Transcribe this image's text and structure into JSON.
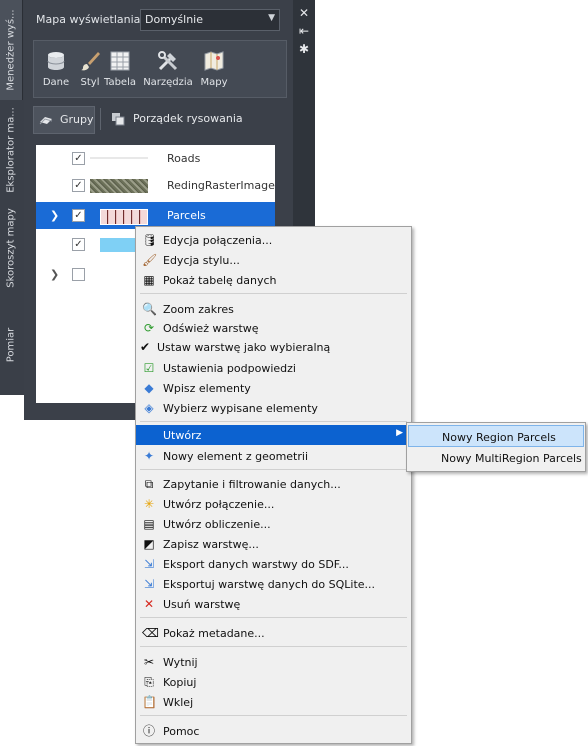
{
  "vertical_tabs": [
    {
      "label": "Menedżer wyś..."
    },
    {
      "label": "Eksplorator ma..."
    },
    {
      "label": "Skoroszyt mapy"
    },
    {
      "label": "Pomiar"
    }
  ],
  "header": {
    "map_label": "Mapa wyświetlania:",
    "map_select_value": "Domyślnie"
  },
  "right_bar_icons": [
    "close-icon",
    "pin-icon",
    "settings-icon"
  ],
  "toolbar": {
    "items": [
      {
        "label": "Dane",
        "icon": "database-icon"
      },
      {
        "label": "Styl",
        "icon": "brush-icon"
      },
      {
        "label": "Tabela",
        "icon": "table-icon"
      },
      {
        "label": "Narzędzia",
        "icon": "tools-icon"
      },
      {
        "label": "Mapy",
        "icon": "map-icon"
      }
    ]
  },
  "group_bar": {
    "groups_label": "Grupy",
    "draw_order_label": "Porządek rysowania"
  },
  "layers": [
    {
      "name": "Roads",
      "checked": true,
      "expanded": false
    },
    {
      "name": "RedingRasterImage",
      "checked": true,
      "expanded": false
    },
    {
      "name": "Parcels",
      "checked": true,
      "selected": true,
      "expandable": true
    },
    {
      "name": "",
      "checked": true
    },
    {
      "name": "",
      "checked": false,
      "expandable": true
    }
  ],
  "context_menu": {
    "group1": [
      {
        "label": "Edycja połączenia...",
        "icon": "database-edit-icon"
      },
      {
        "label": "Edycja stylu...",
        "icon": "brush-icon"
      },
      {
        "label": "Pokaż tabelę danych",
        "icon": "table-icon"
      }
    ],
    "group2": [
      {
        "label": "Zoom zakres",
        "icon": "zoom-extent-icon"
      },
      {
        "label": "Odśwież warstwę",
        "icon": "refresh-icon"
      },
      {
        "label": "Ustaw warstwę jako wybieralną",
        "icon": "check-icon"
      },
      {
        "label": "Ustawienia podpowiedzi",
        "icon": "tooltip-settings-icon"
      },
      {
        "label": "Wpisz elementy",
        "icon": "shapes-icon"
      },
      {
        "label": "Wybierz wypisane elementy",
        "icon": "select-shapes-icon"
      }
    ],
    "group3": [
      {
        "label": "Utwórz",
        "icon": "",
        "has_submenu": true
      },
      {
        "label": "Nowy element z geometrii",
        "icon": "new-feature-icon"
      }
    ],
    "group4": [
      {
        "label": "Zapytanie i filtrowanie danych...",
        "icon": "query-icon"
      },
      {
        "label": "Utwórz połączenie...",
        "icon": "create-join-icon"
      },
      {
        "label": "Utwórz obliczenie...",
        "icon": "calculator-icon"
      },
      {
        "label": "Zapisz warstwę...",
        "icon": "save-layer-icon"
      },
      {
        "label": "Eksport danych warstwy do SDF...",
        "icon": "export-sdf-icon"
      },
      {
        "label": "Eksportuj warstwę danych do SQLite...",
        "icon": "export-sqlite-icon"
      },
      {
        "label": "Usuń warstwę",
        "icon": "delete-icon"
      }
    ],
    "group5": [
      {
        "label": "Pokaż metadane...",
        "icon": "metadata-icon"
      }
    ],
    "group6": [
      {
        "label": "Wytnij",
        "icon": "cut-icon"
      },
      {
        "label": "Kopiuj",
        "icon": "copy-icon"
      },
      {
        "label": "Wklej",
        "icon": "paste-icon"
      }
    ],
    "group7": [
      {
        "label": "Pomoc",
        "icon": "help-icon"
      }
    ]
  },
  "submenu": {
    "items": [
      {
        "label": "Nowy Region Parcels",
        "highlighted": true
      },
      {
        "label": "Nowy MultiRegion Parcels",
        "highlighted": false
      }
    ]
  },
  "colors": {
    "panel_bg": "#3b4049",
    "selection_blue": "#1a6bd6",
    "menu_highlight": "#0c62d0"
  }
}
